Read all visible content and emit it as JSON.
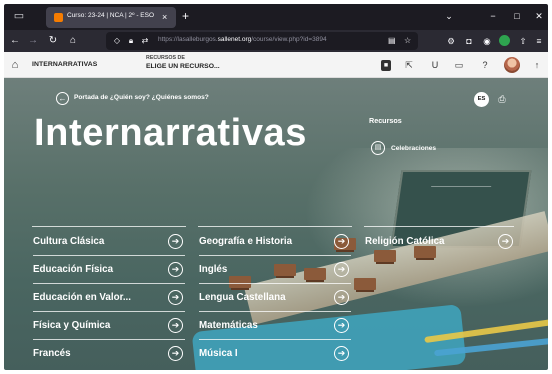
{
  "browser": {
    "tab_title": "Curso: 23-24 | NCA | 2º - ESO",
    "tab_close": "×",
    "new_tab": "+",
    "url_prefix": "https://lasalleburgos.",
    "url_domain": "sallenet.org",
    "url_suffix": "/course/view.php?id=3894"
  },
  "site": {
    "course_short": "INTERNARRATIVAS",
    "selector_label": "RECURSOS DE",
    "selector_value": "ELIGE UN RECURSO..."
  },
  "page": {
    "breadcrumb": "Portada de ¿Quién soy? ¿Quiénes somos?",
    "language": "ES",
    "title": "Internarrativas",
    "resources_title": "Recursos",
    "resources": [
      {
        "label": "Celebraciones"
      }
    ]
  },
  "subjects": {
    "col1": [
      {
        "label": "Cultura Clásica"
      },
      {
        "label": "Educación Física"
      },
      {
        "label": "Educación en Valor..."
      },
      {
        "label": "Física y Química"
      },
      {
        "label": "Francés"
      }
    ],
    "col2": [
      {
        "label": "Geografía e Historia"
      },
      {
        "label": "Inglés"
      },
      {
        "label": "Lengua Castellana"
      },
      {
        "label": "Matemáticas"
      },
      {
        "label": "Música I"
      }
    ],
    "col3": [
      {
        "label": "Religión Católica"
      }
    ]
  },
  "colors": {
    "browser_dark": "#1c1b22",
    "browser_toolbar": "#2b2a33",
    "content_bg": "#587069",
    "text_light": "#ffffff"
  },
  "icons": {
    "arrow_circle": "➔",
    "back_circle": "←"
  }
}
